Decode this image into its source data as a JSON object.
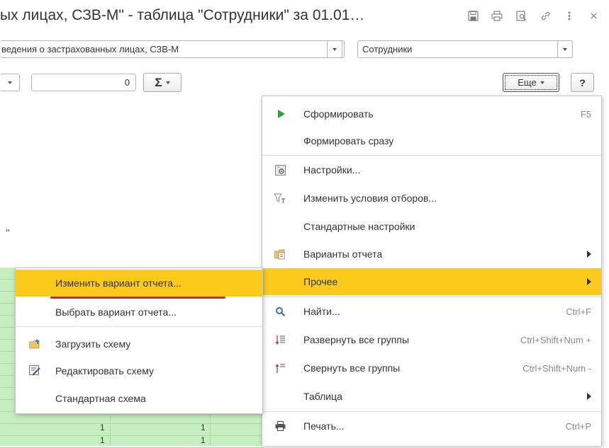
{
  "window": {
    "title": "ых лицах, СЗВ-М\" - таблица \"Сотрудники\" за 01.01…",
    "icons": [
      "save-icon",
      "print-icon",
      "preview-icon",
      "link-icon",
      "more-vertical-icon",
      "close-icon"
    ]
  },
  "toolbar": {
    "report_field_value": "ведения о застрахованных лицах, СЗВ-М",
    "variant_field_value": "Сотрудники",
    "number_field_value": "0",
    "sum_label": "Σ",
    "more_label": "Еще",
    "help_label": "?",
    "stray_quote": "\""
  },
  "grid": {
    "visible_values": [
      "1",
      "1",
      "1",
      "1"
    ],
    "highlight_color": "#c5efbf"
  },
  "main_menu": {
    "items": [
      {
        "label": "Сформировать",
        "shortcut": "F5",
        "icon": "play-icon"
      },
      {
        "label": "Формировать сразу",
        "shortcut": "",
        "icon": ""
      },
      {
        "label": "Настройки...",
        "shortcut": "",
        "icon": "settings-icon"
      },
      {
        "label": "Изменить условия отборов...",
        "shortcut": "",
        "icon": "filter-icon"
      },
      {
        "label": "Стандартные настройки",
        "shortcut": "",
        "icon": ""
      },
      {
        "label": "Варианты отчета",
        "shortcut": "",
        "icon": "report-variants-icon",
        "submenu": true
      },
      {
        "label": "Прочее",
        "shortcut": "",
        "icon": "",
        "submenu": true,
        "highlighted": true
      },
      {
        "label": "Найти...",
        "shortcut": "Ctrl+F",
        "icon": "search-icon"
      },
      {
        "label": "Развернуть все группы",
        "shortcut": "Ctrl+Shift+Num +",
        "icon": "expand-groups-icon"
      },
      {
        "label": "Свернуть все группы",
        "shortcut": "Ctrl+Shift+Num -",
        "icon": "collapse-groups-icon"
      },
      {
        "label": "Таблица",
        "shortcut": "",
        "icon": "",
        "submenu": true
      },
      {
        "label": "Печать...",
        "shortcut": "Ctrl+P",
        "icon": "print-icon"
      }
    ]
  },
  "sub_menu": {
    "items": [
      {
        "label": "Изменить вариант отчета...",
        "icon": "",
        "highlighted": true
      },
      {
        "label": "Выбрать вариант отчета...",
        "icon": ""
      },
      {
        "label": "Загрузить схему",
        "icon": "folder-load-icon"
      },
      {
        "label": "Редактировать схему",
        "icon": "edit-schema-icon"
      },
      {
        "label": "Стандартная схема",
        "icon": ""
      }
    ]
  },
  "colors": {
    "highlight": "#fbca1b",
    "annotation_underline": "#e02020",
    "play_icon": "#2ea043"
  }
}
